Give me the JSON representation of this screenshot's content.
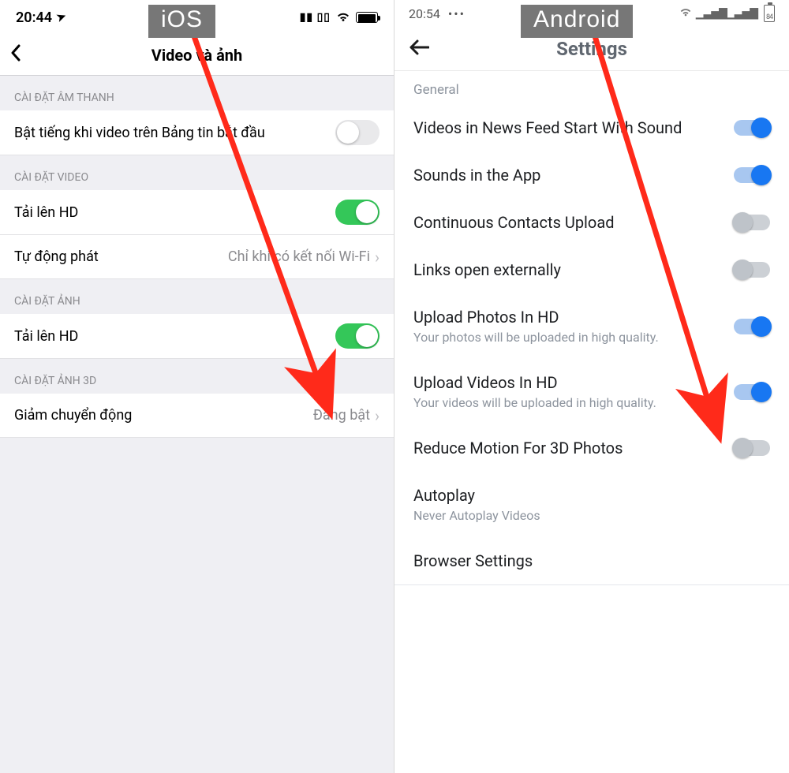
{
  "ios": {
    "badge": "iOS",
    "status": {
      "time": "20:44",
      "location_glyph": "➤"
    },
    "header": {
      "title": "Video và ảnh"
    },
    "sections": {
      "sound": {
        "title": "CÀI ĐẶT ÂM THANH",
        "row1": {
          "label": "Bật tiếng khi video trên Bảng tin bắt đầu",
          "on": false
        }
      },
      "video": {
        "title": "CÀI ĐẶT VIDEO",
        "row1": {
          "label": "Tải lên HD",
          "on": true
        },
        "row2": {
          "label": "Tự động phát",
          "detail": "Chỉ khi có kết nối Wi-Fi"
        }
      },
      "photo": {
        "title": "CÀI ĐẶT ẢNH",
        "row1": {
          "label": "Tải lên HD",
          "on": true
        }
      },
      "photo3d": {
        "title": "CÀI ĐẶT ẢNH 3D",
        "row1": {
          "label": "Giảm chuyển động",
          "detail": "Đang bật"
        }
      }
    }
  },
  "android": {
    "badge": "Android",
    "status": {
      "time": "20:54",
      "menu_glyph": "•••",
      "battery": "84"
    },
    "header": {
      "title": "Settings"
    },
    "general_label": "General",
    "rows": {
      "sound_feed": {
        "label": "Videos in News Feed Start With Sound",
        "on": true
      },
      "sounds_app": {
        "label": "Sounds in the App",
        "on": true
      },
      "contacts": {
        "label": "Continuous Contacts Upload",
        "on": false
      },
      "links": {
        "label": "Links open externally",
        "on": false
      },
      "photos_hd": {
        "label": "Upload Photos In HD",
        "sub": "Your photos will be uploaded in high quality.",
        "on": true
      },
      "videos_hd": {
        "label": "Upload Videos In HD",
        "sub": "Your videos will be uploaded in high quality.",
        "on": true
      },
      "reduce_motion": {
        "label": "Reduce Motion For 3D Photos",
        "on": false
      },
      "autoplay": {
        "label": "Autoplay",
        "sub": "Never Autoplay Videos"
      },
      "browser": {
        "label": "Browser Settings"
      }
    }
  }
}
